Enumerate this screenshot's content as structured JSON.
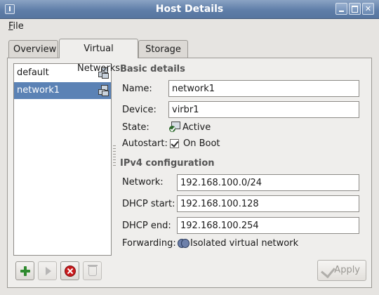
{
  "window": {
    "title": "Host Details"
  },
  "menu": {
    "file_label": "File",
    "file_mnemonic": "F",
    "file_rest": "ile"
  },
  "tabs": [
    {
      "label": "Overview",
      "selected": false
    },
    {
      "label": "Virtual Networks",
      "selected": true
    },
    {
      "label": "Storage",
      "selected": false
    }
  ],
  "networks": [
    {
      "name": "default",
      "selected": false,
      "icon": "network-icon"
    },
    {
      "name": "network1",
      "selected": true,
      "icon": "network-icon"
    }
  ],
  "basic_details": {
    "heading": "Basic details",
    "name_label": "Name:",
    "name_value": "network1",
    "device_label": "Device:",
    "device_value": "virbr1",
    "state_label": "State:",
    "state_value": "Active",
    "autostart_label": "Autostart:",
    "autostart_checked": true,
    "autostart_value": "On Boot"
  },
  "ipv4": {
    "heading": "IPv4 configuration",
    "network_label": "Network:",
    "network_value": "192.168.100.0/24",
    "dhcp_start_label": "DHCP start:",
    "dhcp_start_value": "192.168.100.128",
    "dhcp_end_label": "DHCP end:",
    "dhcp_end_value": "192.168.100.254",
    "forwarding_label": "Forwarding:",
    "forwarding_value": "Isolated virtual network"
  },
  "buttons": {
    "apply_label": "Apply",
    "add_enabled": true,
    "start_enabled": false,
    "stop_enabled": true,
    "delete_enabled": false,
    "apply_enabled": false
  },
  "colors": {
    "titlebar": "#6a88b0",
    "selection": "#5b82b5",
    "window_bg": "#e6e4e1",
    "add_icon": "#2f8a2f",
    "stop_icon": "#c9191c"
  }
}
